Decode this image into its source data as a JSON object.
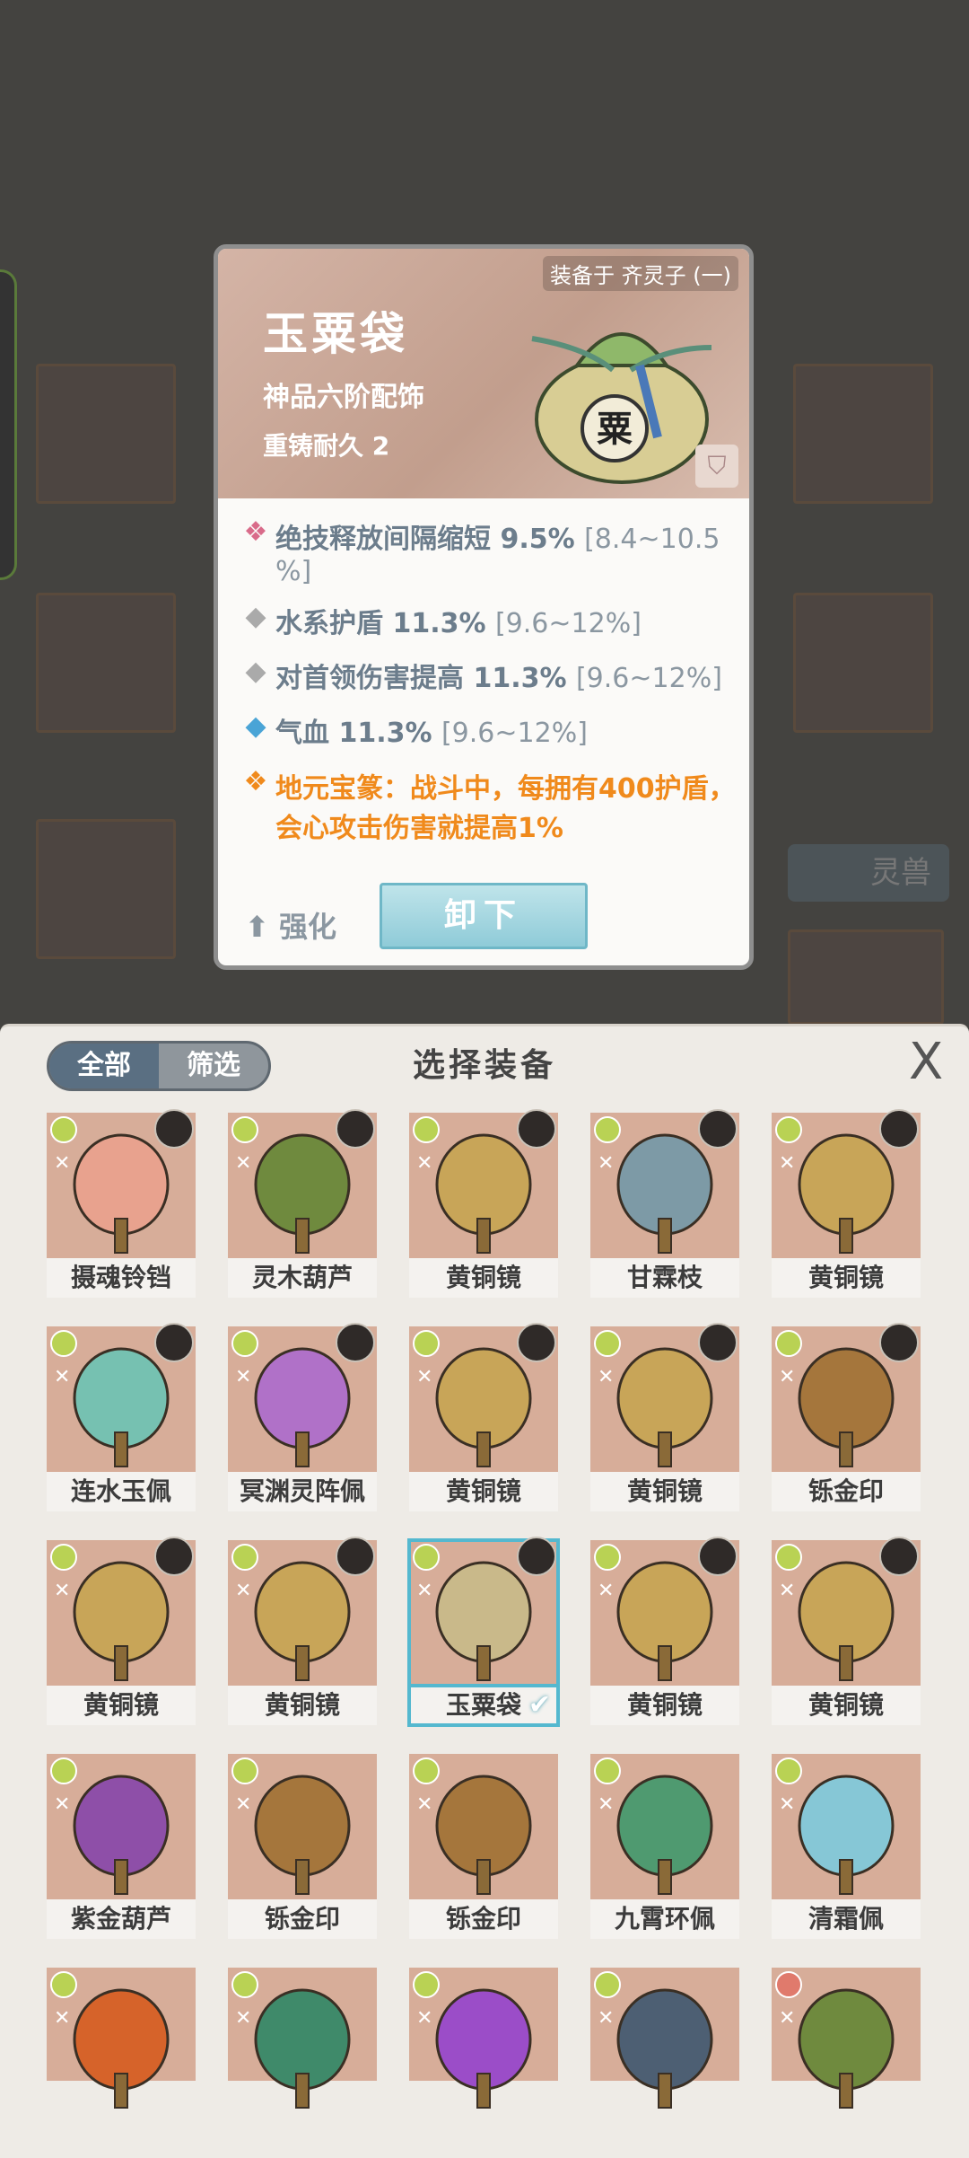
{
  "detail": {
    "equipped_label": "装备于 齐灵子 (一)",
    "name": "玉粟袋",
    "grade": "神品六阶配饰",
    "durability": "重铸耐久 2",
    "stats": [
      {
        "main": "绝技释放间隔缩短 9.5% ",
        "range": "[8.4~10.5",
        "range2": "%]",
        "icon": "flame-icon"
      },
      {
        "main": "水系护盾 11.3% ",
        "range": "[9.6~12%]",
        "icon": "diamond-icon"
      },
      {
        "main": "对首领伤害提高 11.3% ",
        "range": "[9.6~12%]",
        "icon": "diamond-icon"
      },
      {
        "main": "气血 11.3% ",
        "range": "[9.6~12%]",
        "icon": "blue-diamond-icon"
      }
    ],
    "special": "地元宝篆：战斗中，每拥有400护盾，会心攻击伤害就提高1%",
    "upgrade_label": "强化",
    "unequip_label": "卸下"
  },
  "panel": {
    "tab_all": "全部",
    "tab_filter": "筛选",
    "title": "选择装备",
    "close": "X"
  },
  "items": [
    {
      "name": "摄魂铃铛",
      "color": "#e8a28e"
    },
    {
      "name": "灵木葫芦",
      "color": "#6f8a3e"
    },
    {
      "name": "黄铜镜",
      "color": "#c8a558"
    },
    {
      "name": "甘霖枝",
      "color": "#7d9aa6"
    },
    {
      "name": "黄铜镜",
      "color": "#c8a558"
    },
    {
      "name": "连水玉佩",
      "color": "#76c1b1"
    },
    {
      "name": "冥渊灵阵佩",
      "color": "#b071c8"
    },
    {
      "name": "黄铜镜",
      "color": "#c8a558"
    },
    {
      "name": "黄铜镜",
      "color": "#c8a558"
    },
    {
      "name": "铄金印",
      "color": "#a5763c"
    },
    {
      "name": "黄铜镜",
      "color": "#c8a558"
    },
    {
      "name": "黄铜镜",
      "color": "#c8a558"
    },
    {
      "name": "玉粟袋",
      "color": "#c9b98a"
    },
    {
      "name": "黄铜镜",
      "color": "#c8a558"
    },
    {
      "name": "黄铜镜",
      "color": "#c8a558"
    },
    {
      "name": "紫金葫芦",
      "color": "#8e4fa8"
    },
    {
      "name": "铄金印",
      "color": "#a5763c"
    },
    {
      "name": "铄金印",
      "color": "#a5763c"
    },
    {
      "name": "九霄环佩",
      "color": "#4f9a70"
    },
    {
      "name": "清霜佩",
      "color": "#86c7d6"
    },
    {
      "name": "",
      "color": "#d6632a"
    },
    {
      "name": "",
      "color": "#3f8a6a"
    },
    {
      "name": "",
      "color": "#9b4dc8"
    },
    {
      "name": "",
      "color": "#4d5f73"
    },
    {
      "name": "",
      "color": "#6f8a3e"
    }
  ]
}
